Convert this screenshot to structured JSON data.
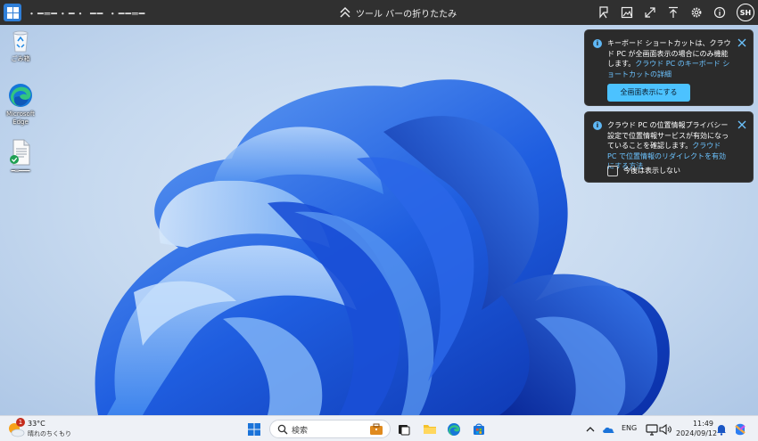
{
  "toolbar": {
    "title": "・━═━・━・ ━━ ・━━═━",
    "collapse_label": "ツール バーの折りたたみ",
    "user_initials": "SH"
  },
  "desktop": {
    "icons": [
      {
        "label": "ごみ箱",
        "icon": "recycle-bin-icon"
      },
      {
        "label": "Microsoft Edge",
        "icon": "edge-icon"
      },
      {
        "label": "━═━━━",
        "icon": "document-icon"
      }
    ]
  },
  "toasts": {
    "keyboard": {
      "message": "キーボード ショートカットは、クラウド PC が全画面表示の場合にのみ機能します。",
      "link": "クラウド PC のキーボード ショートカットの詳細",
      "button": "全画面表示にする"
    },
    "location": {
      "message": "クラウド PC の位置情報プライバシー設定で位置情報サービスが有効になっていることを確認します。",
      "link": "クラウド PC で位置情報のリダイレクトを有効にする方法",
      "checkbox_label": "今後は表示しない",
      "checkbox_checked": false
    }
  },
  "taskbar": {
    "weather": {
      "temp": "33°C",
      "condition": "晴れのちくもり",
      "badge": "1"
    },
    "search_placeholder": "検索",
    "language": "ENG",
    "time": "11:49",
    "date": "2024/09/12"
  },
  "colors": {
    "accent": "#4cc2ff",
    "link": "#6cc3ff",
    "toolbar_bg": "#303030",
    "toast_bg": "#2b2b2b"
  }
}
